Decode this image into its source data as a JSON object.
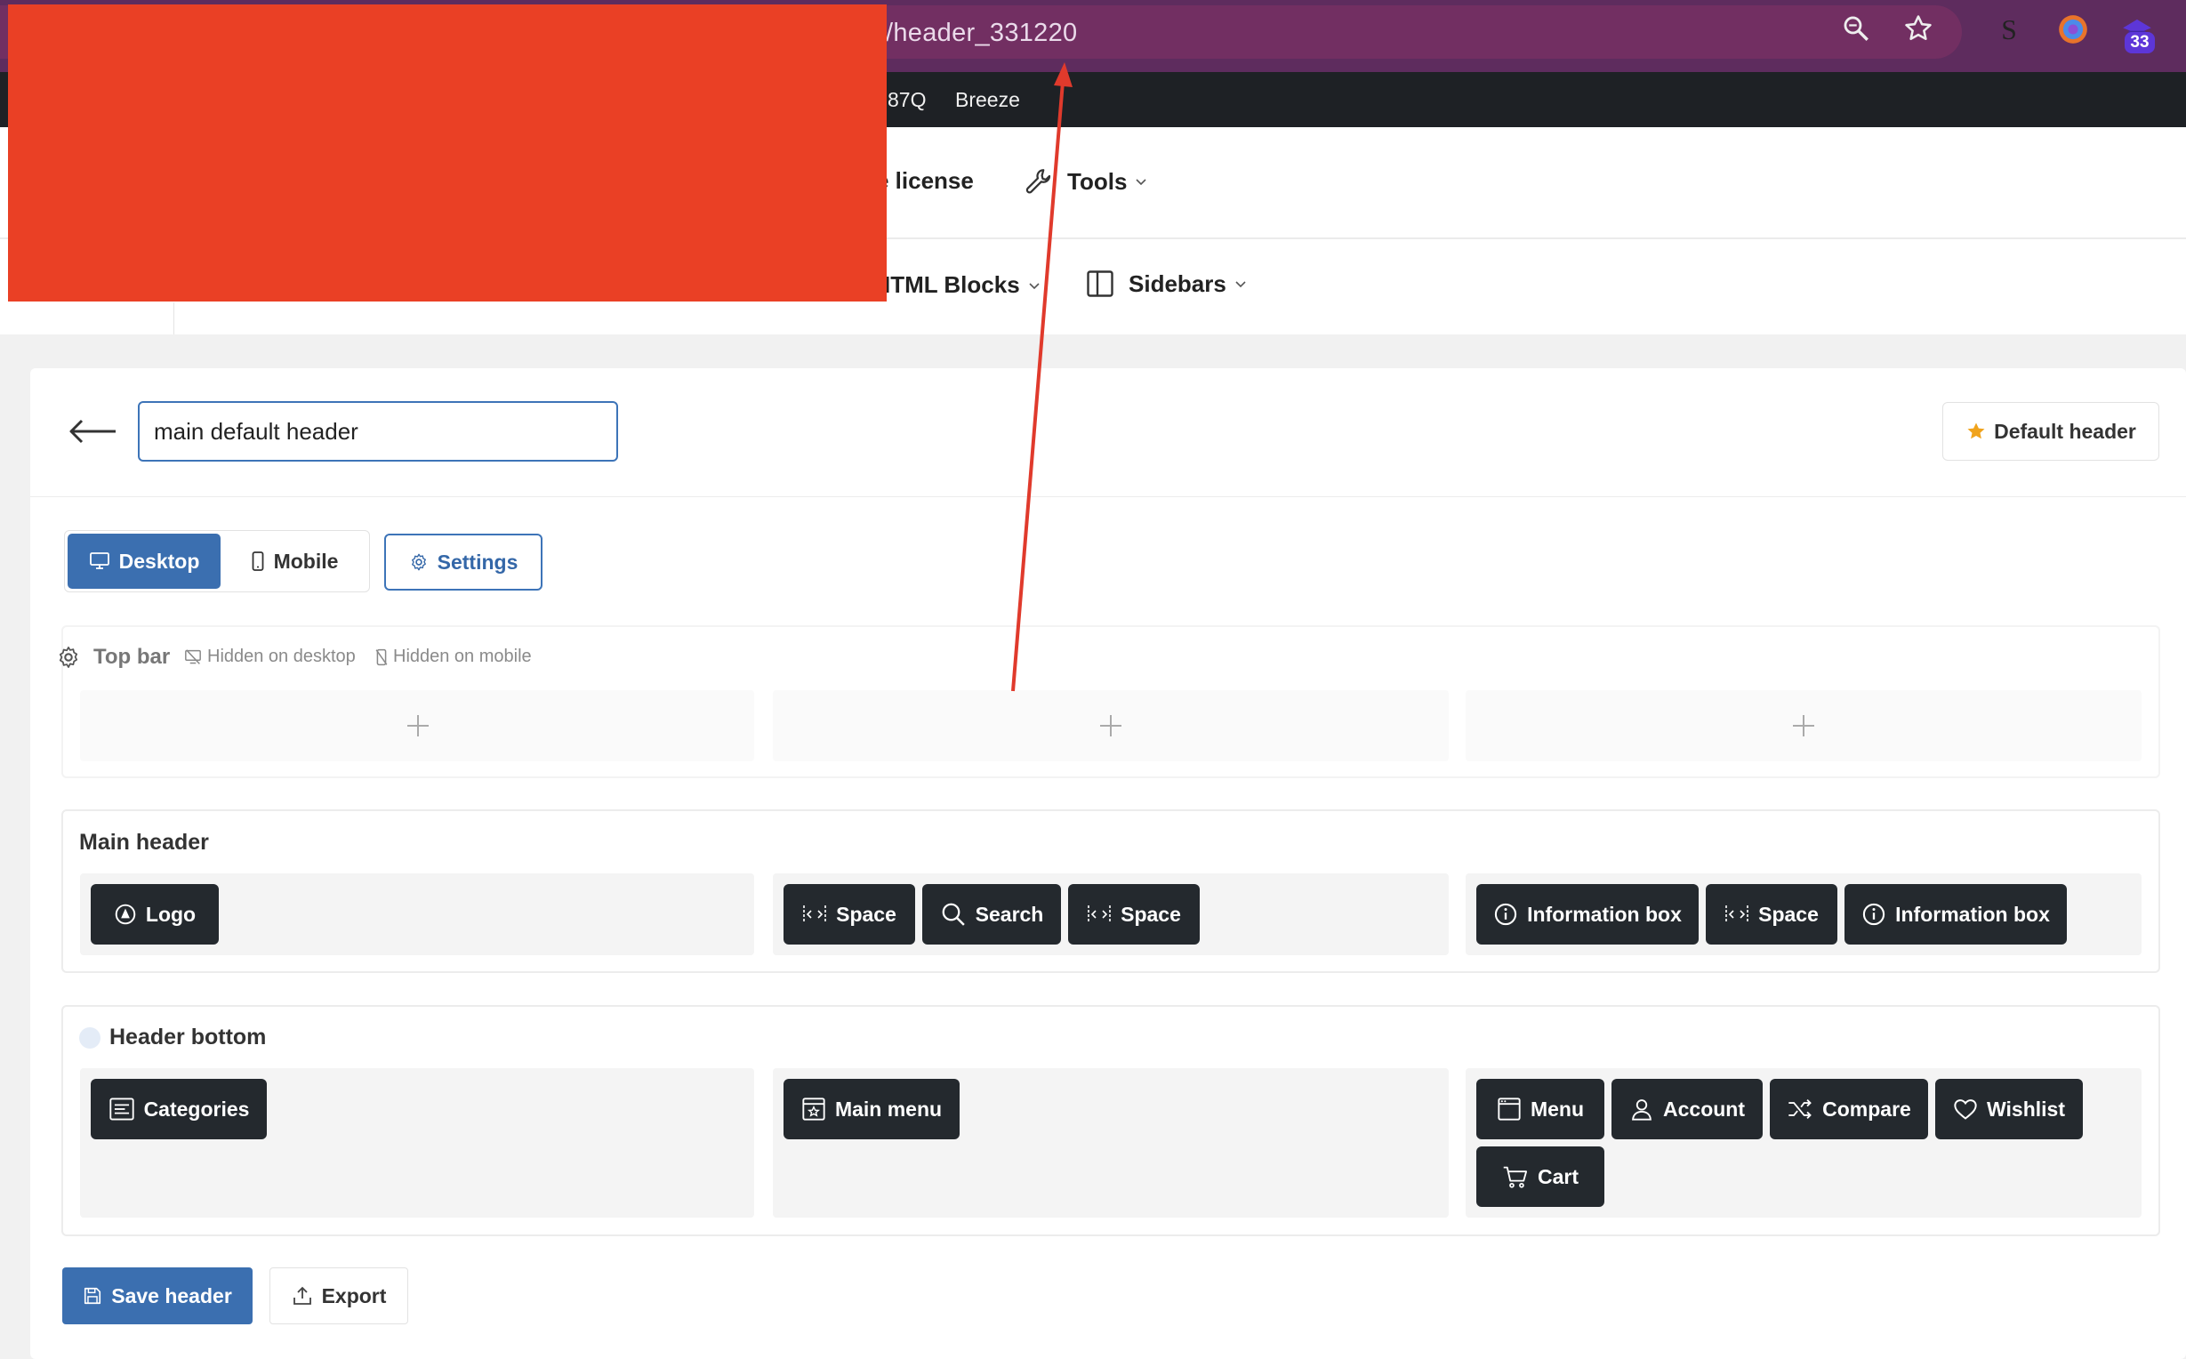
{
  "browser": {
    "url_text": "/header_331220",
    "extension_badge": "33"
  },
  "bookmarks": [
    "87Q",
    "Breeze"
  ],
  "wp_nav": {
    "row1": [
      {
        "label": "e license",
        "icon": "none"
      },
      {
        "label": "Tools",
        "icon": "wrench-icon"
      }
    ],
    "row2": [
      {
        "label": "ITML Blocks",
        "icon": "none"
      },
      {
        "label": "Sidebars",
        "icon": "sidebar-icon"
      }
    ]
  },
  "builder": {
    "header_name": "main default header",
    "default_header_label": "Default header",
    "view_tabs": {
      "desktop": "Desktop",
      "mobile": "Mobile"
    },
    "settings_label": "Settings",
    "rows": {
      "top_bar": {
        "title": "Top bar",
        "hidden_desktop": "Hidden on desktop",
        "hidden_mobile": "Hidden on mobile"
      },
      "main_header": {
        "title": "Main header",
        "columns": [
          [
            {
              "label": "Logo",
              "icon": "logo-icon"
            }
          ],
          [
            {
              "label": "Space",
              "icon": "space-icon"
            },
            {
              "label": "Search",
              "icon": "search-icon"
            },
            {
              "label": "Space",
              "icon": "space-icon"
            }
          ],
          [
            {
              "label": "Information box",
              "icon": "info-icon"
            },
            {
              "label": "Space",
              "icon": "space-icon"
            },
            {
              "label": "Information box",
              "icon": "info-icon"
            }
          ]
        ]
      },
      "header_bottom": {
        "title": "Header bottom",
        "columns": [
          [
            {
              "label": "Categories",
              "icon": "categories-icon"
            }
          ],
          [
            {
              "label": "Main menu",
              "icon": "main-menu-icon"
            }
          ],
          [
            {
              "label": "Menu",
              "icon": "menu-icon"
            },
            {
              "label": "Account",
              "icon": "account-icon"
            },
            {
              "label": "Compare",
              "icon": "compare-icon"
            },
            {
              "label": "Wishlist",
              "icon": "heart-icon"
            },
            {
              "label": "Cart",
              "icon": "cart-icon"
            }
          ]
        ]
      }
    },
    "save_label": "Save header",
    "export_label": "Export"
  },
  "colors": {
    "primary": "#3b6fb0",
    "chip_bg": "#24292e",
    "redaction": "#ea4025",
    "annotation_arrow": "#e03a2c",
    "browser_bar": "#5e2c5e"
  }
}
